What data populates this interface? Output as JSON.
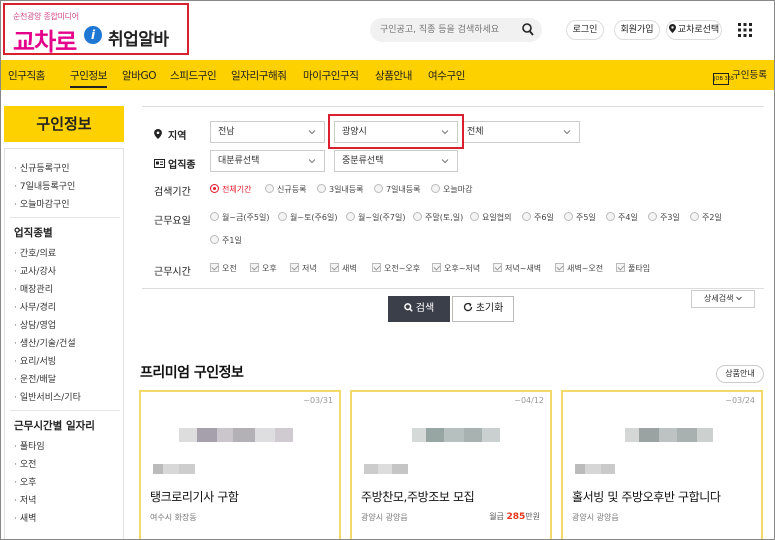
{
  "header": {
    "logo_sub": "순천광양 종합미디어",
    "logo_main": "교차로",
    "logo_icon": "i",
    "logo_text2": "취업알바",
    "search_placeholder": "구인공고, 직종 등을 검색하세요",
    "login": "로그인",
    "join": "회원가입",
    "region": "교차로선택"
  },
  "nav": {
    "items": [
      "인구직홈",
      "구인정보",
      "알바GO",
      "스피드구인",
      "일자리구해줘",
      "마이구인구직",
      "상품안내",
      "여수구인"
    ],
    "register": "구인등록",
    "register_icon_text": "JOB 365"
  },
  "sidebar": {
    "title": "구인정보",
    "top_links": [
      "신규등록구인",
      "7일내등록구인",
      "오늘마감구인"
    ],
    "cat_title": "업직종별",
    "cat_links": [
      "간호/의료",
      "교사/강사",
      "매장관리",
      "사무/경리",
      "상담/영업",
      "생산/기술/건설",
      "요리/서빙",
      "운전/배달",
      "일반서비스/기타"
    ],
    "time_title": "근무시간별 일자리",
    "time_links": [
      "풀타임",
      "오전",
      "오후",
      "저녁",
      "새벽"
    ]
  },
  "filter": {
    "region_label": "지역",
    "region_select1": "전남",
    "region_select2": "광양시",
    "region_select3": "전체",
    "job_label": "업직종",
    "job_select1": "대분류선택",
    "job_select2": "중분류선택",
    "period_label": "검색기간",
    "period_options": [
      "전체기간",
      "신규등록",
      "3일내등록",
      "7일내등록",
      "오늘마감"
    ],
    "days_label": "근무요일",
    "days_options": [
      "월~금(주5일)",
      "월~토(주6일)",
      "월~일(주7일)",
      "주말(토,일)",
      "요일협의",
      "주6일",
      "주5일",
      "주4일",
      "주3일",
      "주2일",
      "주1일"
    ],
    "hours_label": "근무시간",
    "hours_options": [
      "오전",
      "오후",
      "저녁",
      "새벽",
      "오전~오후",
      "오후~저녁",
      "저녁~새벽",
      "새벽~오전",
      "풀타임"
    ],
    "search_btn": "검색",
    "reset_btn": "초기화",
    "detail_btn": "상세검색"
  },
  "premium": {
    "title": "프리미엄 구인정보",
    "guide_btn": "상품안내",
    "cards": [
      {
        "date": "~03/31",
        "title": "탱크로리기사 구함",
        "location": "여수시 화장동",
        "pay_label": "",
        "pay_amount": "",
        "pay_unit": ""
      },
      {
        "date": "~04/12",
        "title": "주방찬모,주방조보 모집",
        "location": "광양시 광양읍",
        "pay_label": "월급",
        "pay_amount": "285",
        "pay_unit": "만원"
      },
      {
        "date": "~03/24",
        "title": "홀서빙 및 주방오후반 구합니다",
        "location": "광양시 광양읍",
        "pay_label": "",
        "pay_amount": "",
        "pay_unit": ""
      }
    ]
  },
  "colors": {
    "brand_yellow": "#fdd000",
    "highlight_red": "#d8202f",
    "logo_pink": "#e4008a"
  }
}
